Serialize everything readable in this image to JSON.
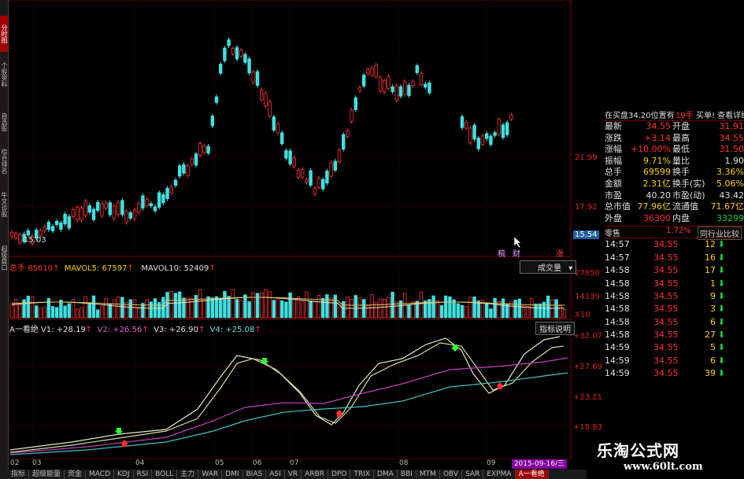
{
  "left_toolbar": {
    "items": [
      {
        "label": "分时图",
        "active": true
      },
      {
        "label": "个股资料",
        "active": false
      },
      {
        "label": "自选股",
        "active": false
      },
      {
        "label": "综合排名",
        "active": false
      },
      {
        "label": "牛叉诊股",
        "active": false
      },
      {
        "label": "超级盘口",
        "active": false
      }
    ]
  },
  "price_axis": {
    "labels": [
      "21.99",
      "17.92",
      "15.54"
    ],
    "low_marker": "15.03"
  },
  "volume_panel": {
    "title": "总手",
    "total": "85610",
    "mavol5_label": "MAVOL5:",
    "mavol5": "67597",
    "mavol10_label": "MAVOL10:",
    "mavol10": "52409",
    "axis_labels": [
      "27850",
      "14139"
    ],
    "unit": "X10",
    "dropdown_label": "成交量"
  },
  "indicator_panel": {
    "name": "A一看绝",
    "v1": "V1: +28.19",
    "v2": "V2: +26.56",
    "v3": "V3: +26.90",
    "v4": "V4: +25.08",
    "axis_labels": [
      "+32.07",
      "+27.69",
      "+23.21",
      "+18.83"
    ],
    "help_button": "指标说明"
  },
  "chart_markers": {
    "a": "稿",
    "b": "财",
    "c": "涨"
  },
  "x_axis": {
    "labels": [
      "02",
      "03",
      "04",
      "05",
      "06",
      "07",
      "08",
      "09"
    ],
    "cursor_date": "2015-09-16/三"
  },
  "quote_panel": {
    "header_left": "在买盘34.20位置有",
    "header_mid": "19手",
    "header_right": "买单! 查看详细",
    "rows": [
      {
        "l1": "最新",
        "v1": "34.55",
        "l2": "开盘",
        "v2": "31.91"
      },
      {
        "l1": "涨跌",
        "v1": "+3.14",
        "l2": "最高",
        "v2": "34.55"
      },
      {
        "l1": "涨幅",
        "v1": "+10.00%",
        "l2": "最低",
        "v2": "31.50"
      },
      {
        "l1": "振幅",
        "v1": "9.71%",
        "l2": "量比",
        "v2": "1.90"
      },
      {
        "l1": "总手",
        "v1": "69599",
        "l2": "换手",
        "v2": "3.36%"
      },
      {
        "l1": "金额",
        "v1": "2.31亿",
        "l2": "换手(实)",
        "v2": "5.06%"
      },
      {
        "l1": "市盈",
        "v1": "40.20",
        "l2": "市盈(动)",
        "v2": "43.42"
      },
      {
        "l1": "总市值",
        "v1": "77.96亿",
        "l2": "流通值",
        "v2": "71.67亿"
      },
      {
        "l1": "外盘",
        "v1": "36300",
        "l2": "内盘",
        "v2": "33299"
      }
    ],
    "industry_label": "零售",
    "industry_pct": "1.72%",
    "industry_button": "同行业比较"
  },
  "ticks": [
    {
      "time": "14:57",
      "price": "34.55",
      "vol": "12"
    },
    {
      "time": "14:57",
      "price": "34.55",
      "vol": "16"
    },
    {
      "time": "14:58",
      "price": "34.55",
      "vol": "17"
    },
    {
      "time": "14:58",
      "price": "34.55",
      "vol": "1"
    },
    {
      "time": "14:58",
      "price": "34.55",
      "vol": "9"
    },
    {
      "time": "14:58",
      "price": "34.55",
      "vol": "3"
    },
    {
      "time": "14:58",
      "price": "34.55",
      "vol": "6"
    },
    {
      "time": "14:58",
      "price": "34.55",
      "vol": "27"
    },
    {
      "time": "14:59",
      "price": "34.55",
      "vol": "5"
    },
    {
      "time": "14:59",
      "price": "34.55",
      "vol": "6"
    },
    {
      "time": "14:59",
      "price": "34.55",
      "vol": "39"
    }
  ],
  "bottom_tabs": [
    "指标",
    "超级能量",
    "资金",
    "MACD",
    "KDJ",
    "RSI",
    "BOLL",
    "主力",
    "WAR",
    "DMI",
    "BIAS",
    "ASI",
    "VR",
    "ARBR",
    "DPO",
    "TRIX",
    "DMA",
    "BBI",
    "MTM",
    "OBV",
    "SAR",
    "EXPMA",
    "A一看绝"
  ],
  "watermark": {
    "title": "乐淘公式网",
    "url": "www.60lt.com"
  },
  "colors": {
    "up": "#ff3030",
    "down": "#40e0e0",
    "ma1": "#e8e8c0",
    "ma2": "#c040c0",
    "ma3": "#40c0c0"
  }
}
